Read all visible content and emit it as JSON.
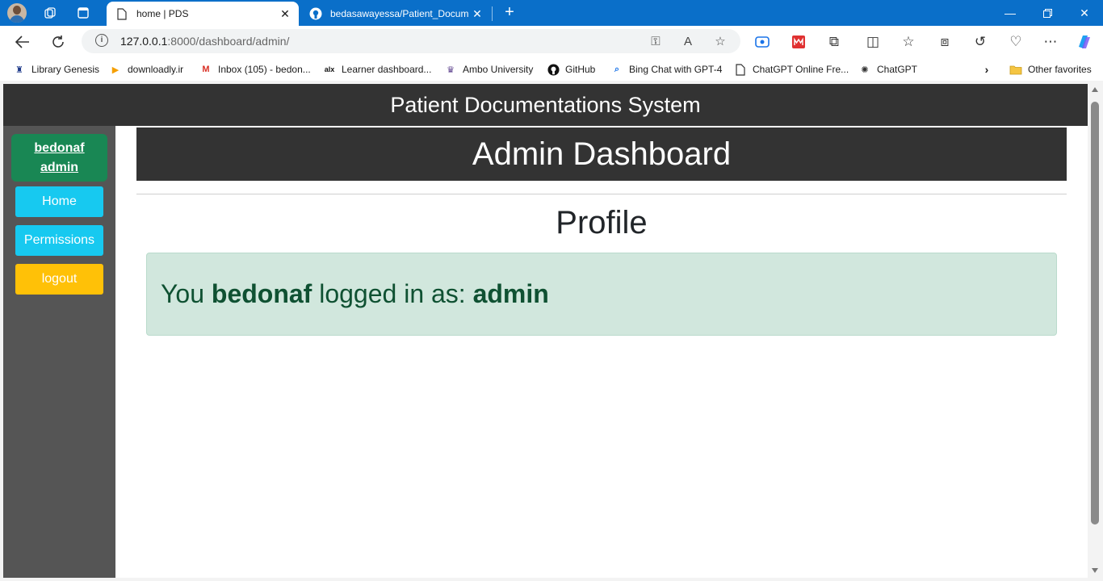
{
  "browser": {
    "tabs": [
      {
        "title": "home | PDS",
        "active": true
      },
      {
        "title": "bedasawayessa/Patient_Documen",
        "active": false
      }
    ],
    "address": {
      "host": "127.0.0.1",
      "rest": ":8000/dashboard/admin/"
    },
    "bookmarks": [
      {
        "label": "Library Genesis",
        "icon": "library-icon"
      },
      {
        "label": "downloadly.ir",
        "icon": "downloadly-icon"
      },
      {
        "label": "Inbox (105) - bedon...",
        "icon": "gmail-icon"
      },
      {
        "label": "Learner dashboard...",
        "icon": "alx-icon"
      },
      {
        "label": "Ambo University",
        "icon": "university-icon"
      },
      {
        "label": "GitHub",
        "icon": "github-icon"
      },
      {
        "label": "Bing Chat with GPT-4",
        "icon": "search-icon"
      },
      {
        "label": "ChatGPT Online Fre...",
        "icon": "page-icon"
      },
      {
        "label": "ChatGPT",
        "icon": "chatgpt-icon"
      }
    ],
    "other_favorites": "Other favorites",
    "accent_color": "#0a6fc9"
  },
  "site": {
    "title": "Patient Documentations System"
  },
  "sidebar": {
    "username": "bedonaf",
    "role": "admin",
    "buttons": {
      "home": "Home",
      "permissions": "Permissions",
      "logout": "logout"
    }
  },
  "main": {
    "dashboard_title": "Admin Dashboard",
    "profile_title": "Profile",
    "alert": {
      "prefix": "You",
      "username": "bedonaf",
      "middle": "logged in as:",
      "role": "admin"
    }
  }
}
